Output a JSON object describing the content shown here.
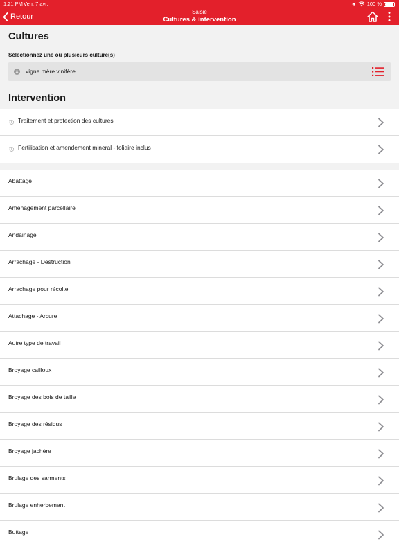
{
  "status_bar": {
    "time": "1:21 PM",
    "date": "Ven. 7 avr.",
    "battery": "100 %"
  },
  "header": {
    "back_label": "Retour",
    "supertitle": "Saisie",
    "title": "Cultures & intervention"
  },
  "cultures": {
    "title": "Cultures",
    "select_label": "Sélectionnez une ou plusieurs culture(s)",
    "selected": [
      "vigne mère vinifère"
    ]
  },
  "intervention": {
    "title": "Intervention",
    "recent": [
      "Traitement et protection des cultures",
      "Fertilisation et amendement mineral - foliaire inclus"
    ],
    "items": [
      "Abattage",
      "Amenagement parcellaire",
      "Andainage",
      "Arrachage - Destruction",
      "Arrachage pour récolte",
      "Attachage - Arcure",
      "Autre type de travail",
      "Broyage cailloux",
      "Broyage des bois de taille",
      "Broyage des résidus",
      "Broyage jachère",
      "Brulage des sarments",
      "Brulage enherbement",
      "Buttage"
    ]
  },
  "colors": {
    "brand": "#e3202b",
    "background": "#f2f2f2",
    "chevron": "#8e8e93"
  },
  "icons": [
    "back-chevron-icon",
    "home-icon",
    "more-vertical-icon",
    "location-arrow-icon",
    "wifi-icon",
    "battery-icon",
    "remove-chip-icon",
    "list-icon",
    "history-icon",
    "chevron-right-icon"
  ]
}
